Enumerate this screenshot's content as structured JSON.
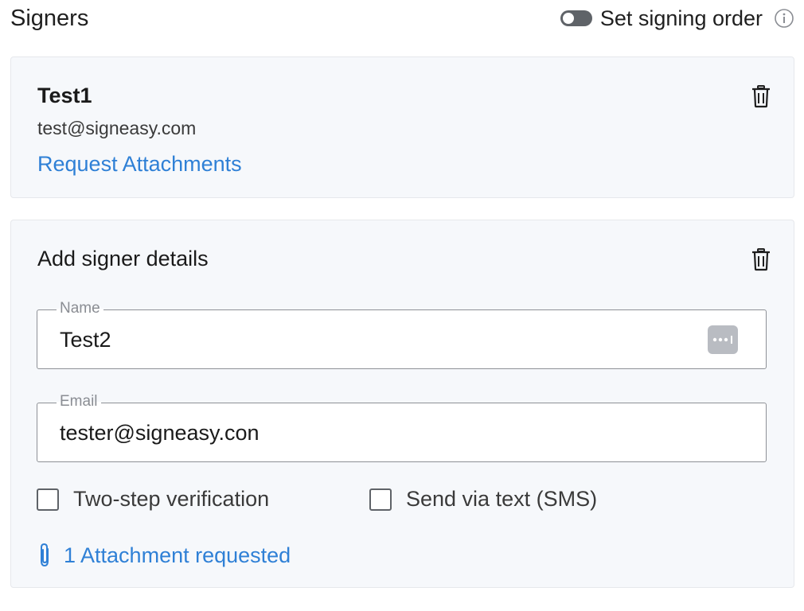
{
  "header": {
    "title": "Signers",
    "signing_order_label": "Set signing order",
    "signing_order_enabled": false
  },
  "signer1": {
    "name": "Test1",
    "email": "test@signeasy.com",
    "request_attachments_label": "Request Attachments"
  },
  "signer2": {
    "title": "Add signer details",
    "name_label": "Name",
    "name_value": "Test2",
    "email_label": "Email",
    "email_value": "tester@signeasy.con",
    "two_step_label": "Two-step verification",
    "two_step_checked": false,
    "sms_label": "Send via text (SMS)",
    "sms_checked": false,
    "attachment_label": "1 Attachment requested"
  },
  "colors": {
    "link": "#2f80d6",
    "card_bg": "#f6f8fb",
    "toggle_off": "#5f6368"
  },
  "icons": {
    "info": "info-icon",
    "trash": "trash-icon",
    "password_manager": "password-manager-icon",
    "attachment": "paperclip-icon"
  }
}
